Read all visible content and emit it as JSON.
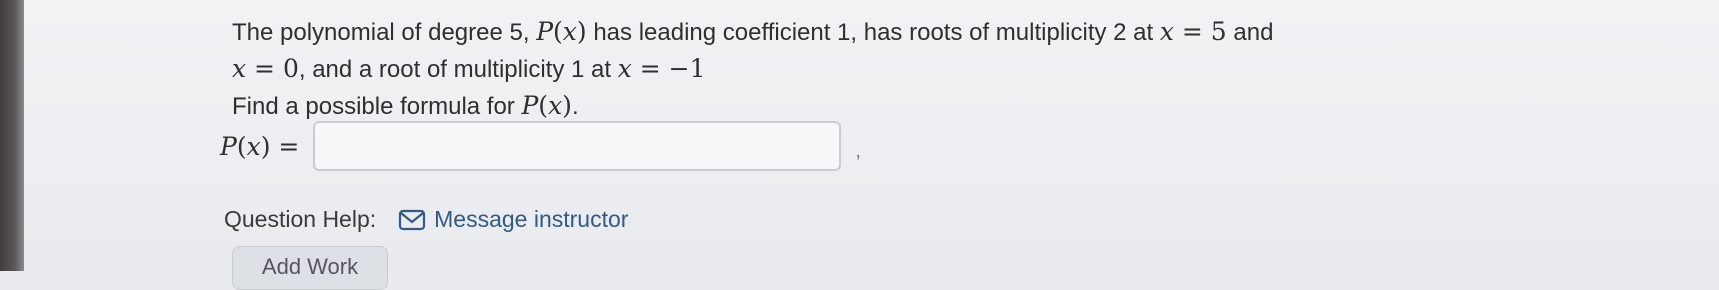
{
  "question": {
    "line1_pre": "The polynomial of degree 5, ",
    "line1_func": "P",
    "line1_var": "x",
    "line1_mid": " has leading coefficient 1, has roots of multiplicity 2 at ",
    "line1_var2": "x",
    "line1_eq": " = 5",
    "line1_post": " and",
    "line2_var": "x",
    "line2_eq": " = 0",
    "line2_mid": ", and a root of multiplicity 1 at ",
    "line2_var2": "x",
    "line2_eq2": " = −1",
    "line3_pre": "Find a possible formula for ",
    "line3_func": "P",
    "line3_var": "x",
    "line3_post": "."
  },
  "answer": {
    "label_func": "P",
    "label_var": "x",
    "label_eq": " =",
    "value": "",
    "trailing_mark": ","
  },
  "help": {
    "label": "Question Help:",
    "link_icon": "mail-icon",
    "link_text": "Message instructor"
  },
  "add_work": {
    "label": "Add Work"
  }
}
